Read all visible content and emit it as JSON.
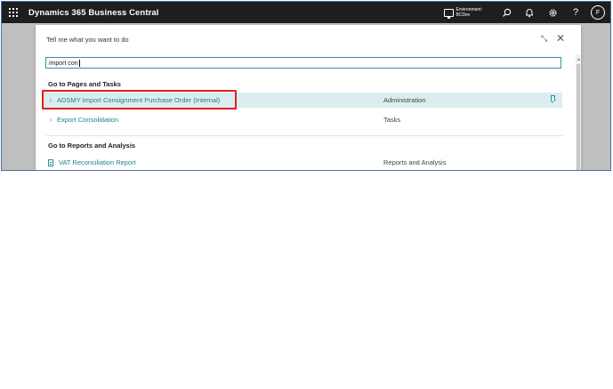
{
  "app": {
    "title": "Dynamics 365 Business Central"
  },
  "topbar": {
    "environment_label": "Environment:",
    "environment_name": "BCDev",
    "user_initial": "F",
    "icons": [
      "waffle-icon",
      "environment-icon",
      "search-icon",
      "bell-icon",
      "gear-icon",
      "help-icon"
    ]
  },
  "tellme": {
    "header": "Tell me what you want to do",
    "search_value": "import con",
    "sections": {
      "pages_title": "Go to Pages and Tasks",
      "reports_title": "Go to Reports and Analysis"
    },
    "pages": [
      {
        "label": "ADSMY Import Consignment Purchase Order (Internal)",
        "category": "Administration",
        "selected": true
      },
      {
        "label": "Export Consolidation",
        "category": "Tasks",
        "selected": false
      }
    ],
    "reports": [
      {
        "label": "VAT Reconciliation Report",
        "category": "Reports and Analysis"
      }
    ]
  },
  "colors": {
    "topbar_bg": "#1e1e1e",
    "accent": "#1f7e8c",
    "selected_row_bg": "#dcedf0",
    "annotation_red": "#e0201c"
  }
}
